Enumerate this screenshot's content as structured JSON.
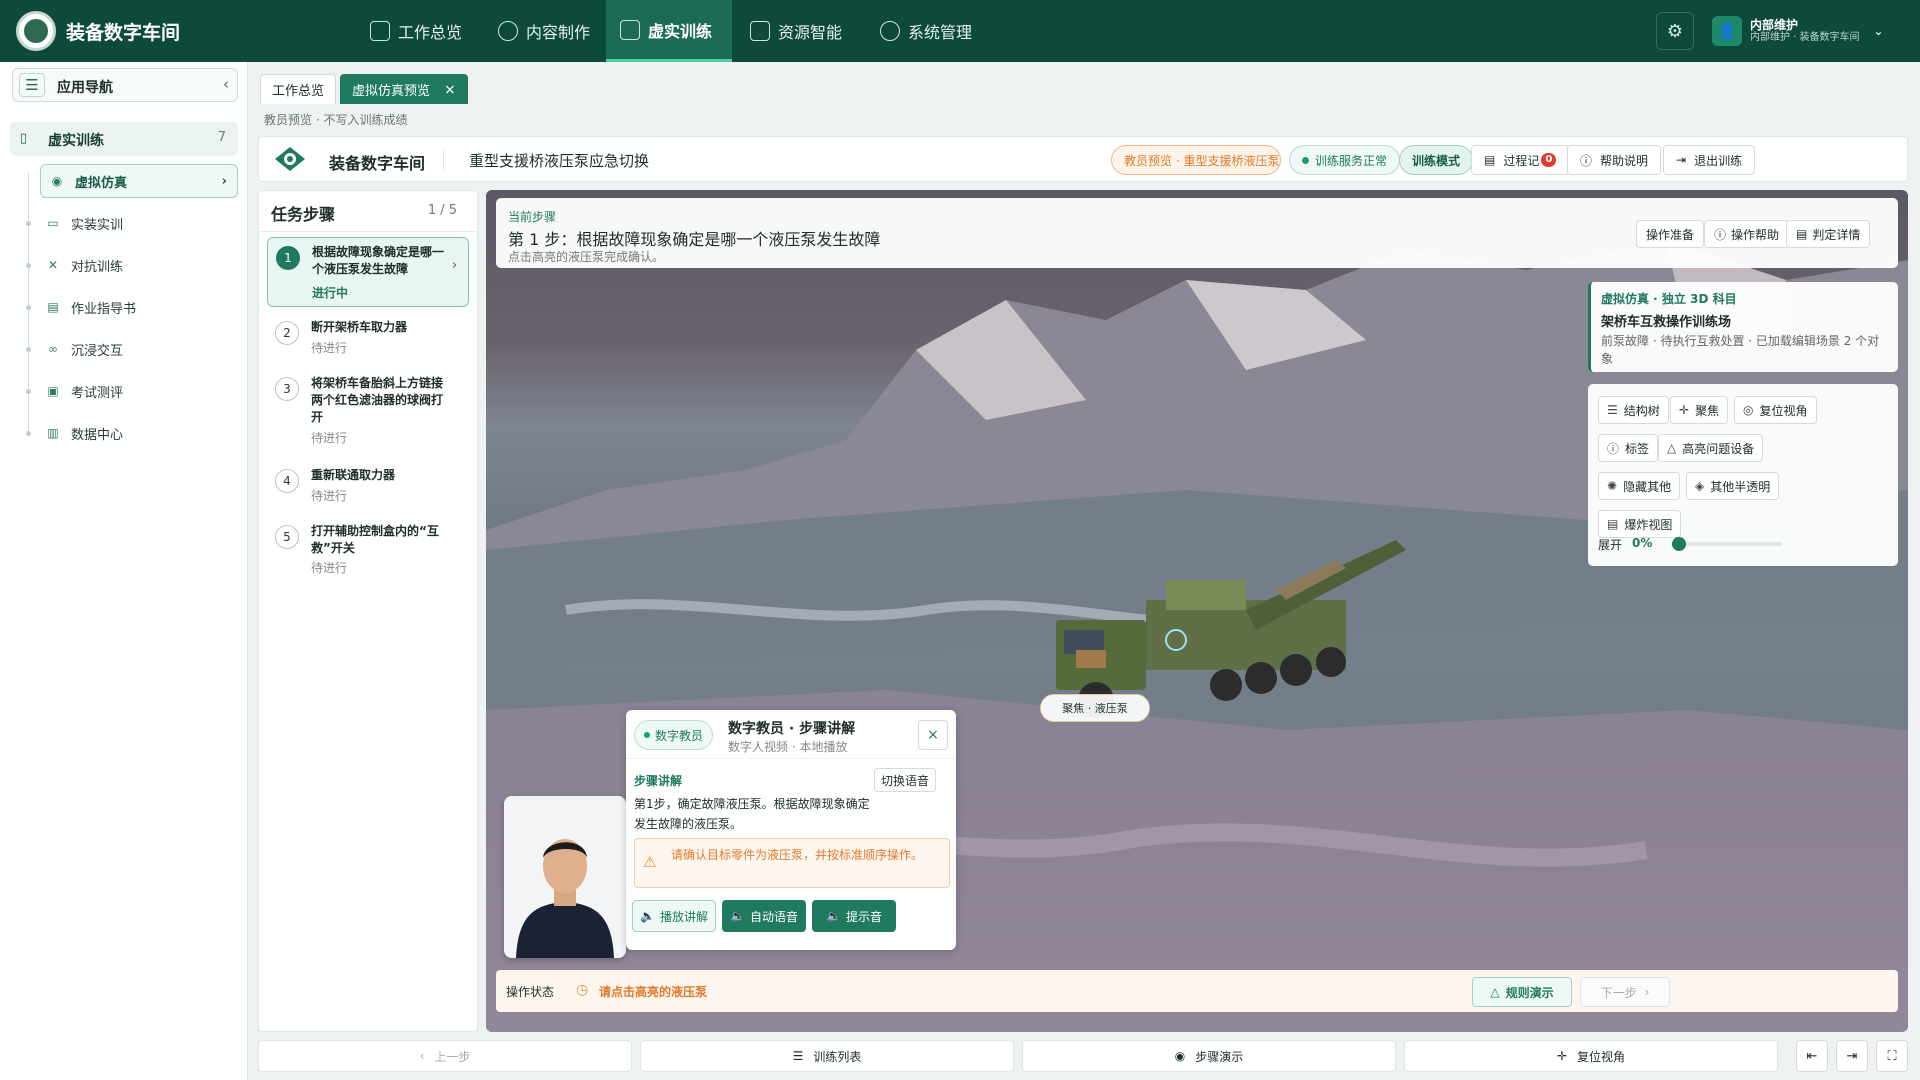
{
  "app": {
    "brand": "装备数字车间"
  },
  "topnav": [
    {
      "label": "工作总览",
      "active": false
    },
    {
      "label": "内容制作",
      "active": false
    },
    {
      "label": "虚实训练",
      "active": true
    },
    {
      "label": "资源智能",
      "active": false
    },
    {
      "label": "系统管理",
      "active": false
    }
  ],
  "user": {
    "name": "内部维护",
    "sub": "内部维护 · 装备数字车间"
  },
  "sidebar": {
    "title": "应用导航",
    "group": {
      "label": "虚实训练",
      "count": "7"
    },
    "items": [
      {
        "label": "虚拟仿真",
        "icon": "play-circle-icon"
      },
      {
        "label": "实装实训",
        "icon": "monitor-icon"
      },
      {
        "label": "对抗训练",
        "icon": "swords-icon"
      },
      {
        "label": "作业指导书",
        "icon": "document-icon"
      },
      {
        "label": "沉浸交互",
        "icon": "vr-icon"
      },
      {
        "label": "考试测评",
        "icon": "clipboard-icon"
      },
      {
        "label": "数据中心",
        "icon": "chart-icon"
      }
    ]
  },
  "tabs": [
    {
      "label": "工作总览"
    },
    {
      "label": "虚拟仿真预览",
      "close": "×"
    }
  ],
  "breadcrumb": "教员预览 · 不写入训练成绩",
  "header": {
    "brand": "装备数字车间",
    "title": "重型支援桥液压泵应急切换",
    "preview_pill": "教员预览 · 重型支援桥液压泵应急切换",
    "service_pill": "训练服务正常",
    "mode_pill": "训练模式",
    "process_label": "过程记",
    "process_count": "0",
    "help_label": "帮助说明",
    "exit_label": "退出训练"
  },
  "steps_panel": {
    "title": "任务步骤",
    "count": "1 / 5",
    "steps": [
      {
        "num": "1",
        "title": "根据故障现象确定是哪一个液压泵发生故障",
        "status": "进行中"
      },
      {
        "num": "2",
        "title": "断开架桥车取力器",
        "status": "待进行"
      },
      {
        "num": "3",
        "title": "将架桥车备胎斜上方链接两个红色滤油器的球阀打开",
        "status": "待进行"
      },
      {
        "num": "4",
        "title": "重新联通取力器",
        "status": "待进行"
      },
      {
        "num": "5",
        "title": "打开辅助控制盒内的“互救”开关",
        "status": "待进行"
      }
    ]
  },
  "current_step": {
    "label": "当前步骤",
    "title": "第 1 步：根据故障现象确定是哪一个液压泵发生故障",
    "desc": "点击高亮的液压泵完成确认。",
    "buttons": [
      "操作准备",
      "操作帮助",
      "判定详情"
    ]
  },
  "info_card": {
    "tag": "虚拟仿真 · 独立 3D 科目",
    "title": "架桥车互救操作训练场",
    "desc": "前泵故障 · 待执行互救处置 · 已加载编辑场景 2 个对象"
  },
  "tools": {
    "buttons": [
      "结构树",
      "聚焦",
      "复位视角",
      "标签",
      "高亮问题设备",
      "隐藏其他",
      "其他半透明",
      "爆炸视图"
    ],
    "expand_label": "展开",
    "expand_value": "0%",
    "expand_fraction": 0
  },
  "focus_label": "聚焦 · 液压泵",
  "tutor": {
    "tag": "数字教员",
    "title": "数字教员 · 步骤讲解",
    "sub": "数字人视频 · 本地播放",
    "close": "×",
    "section": "步骤讲解",
    "switch_voice": "切换语音",
    "body": "第1步，确定故障液压泵。根据故障现象确定发生故障的液压泵。",
    "warning": "请确认目标零件为液压泵，并按标准顺序操作。",
    "buttons": [
      "播放讲解",
      "自动语音",
      "提示音"
    ]
  },
  "opbar": {
    "label": "操作状态",
    "status": "请点击高亮的液压泵",
    "rule_demo": "规则演示",
    "next": "下一步"
  },
  "bottom": {
    "prev": "上一步",
    "list": "训练列表",
    "demo": "步骤演示",
    "reset": "复位视角"
  }
}
